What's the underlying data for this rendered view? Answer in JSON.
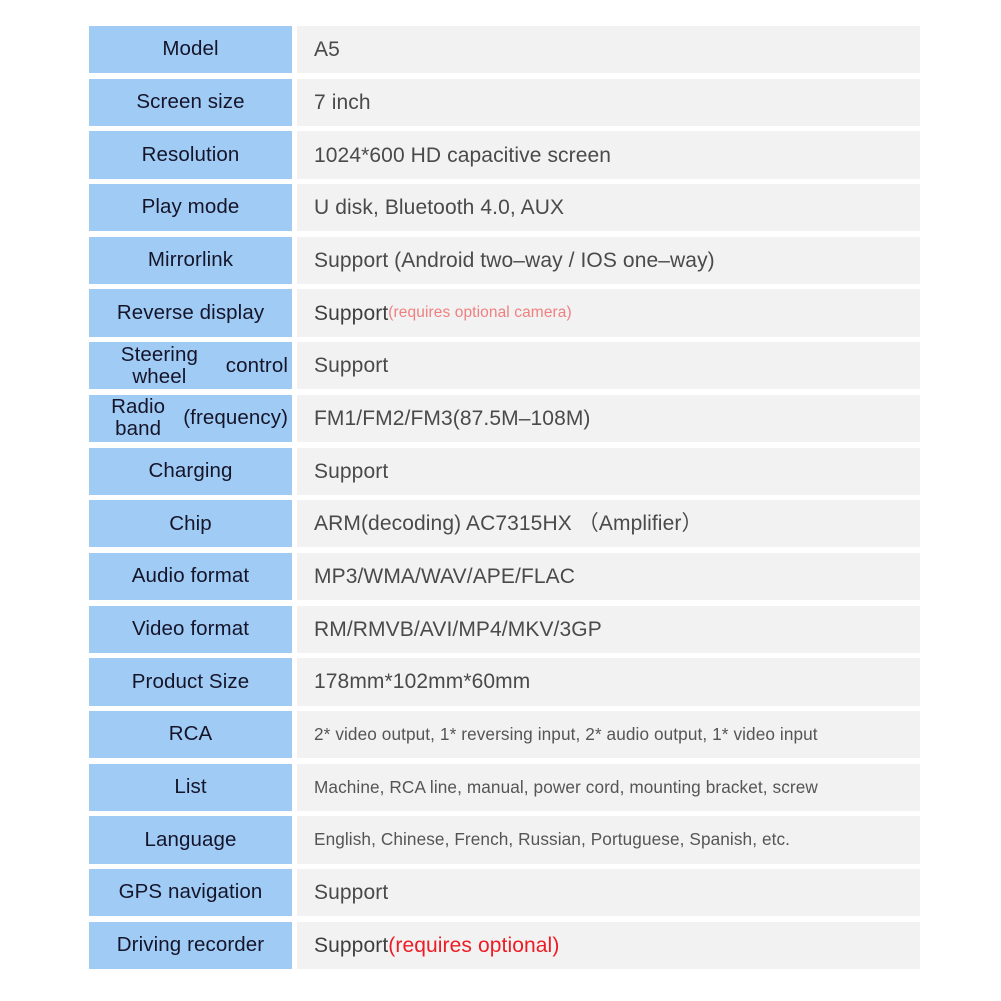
{
  "table": {
    "colors": {
      "label_background": "#a0cbf5",
      "value_background": "#f2f2f2",
      "label_text": "#15152a",
      "value_text": "#4a4a4a",
      "note_soft": "#f08080",
      "note_strong": "#ed1c24"
    },
    "rows": [
      {
        "label": "Model",
        "value": "A5"
      },
      {
        "label": "Screen size",
        "value": "7 inch"
      },
      {
        "label": "Resolution",
        "value": "1024*600 HD capacitive screen"
      },
      {
        "label": "Play mode",
        "value": "U disk, Bluetooth 4.0, AUX"
      },
      {
        "label": "Mirrorlink",
        "value": "Support (Android two–way / IOS one–way)"
      },
      {
        "label": "Reverse display",
        "value": "Support",
        "note": "(requires optional camera)",
        "note_style": "soft"
      },
      {
        "label": "Steering wheel control",
        "label_line1": "Steering wheel",
        "label_line2": "control",
        "value": "Support"
      },
      {
        "label": "Radio band (frequency)",
        "label_line1": "Radio band",
        "label_line2": "(frequency)",
        "value": "FM1/FM2/FM3(87.5M–108M)"
      },
      {
        "label": "Charging",
        "value": "Support"
      },
      {
        "label": "Chip",
        "value": "ARM(decoding)   AC7315HX （Amplifier）"
      },
      {
        "label": "Audio format",
        "value": "MP3/WMA/WAV/APE/FLAC"
      },
      {
        "label": "Video format",
        "value": "RM/RMVB/AVI/MP4/MKV/3GP"
      },
      {
        "label": "Product Size",
        "value": "178mm*102mm*60mm"
      },
      {
        "label": "RCA",
        "value": "2* video output, 1* reversing input, 2* audio output, 1* video input",
        "size": "small"
      },
      {
        "label": "List",
        "value": "Machine, RCA line, manual, power cord, mounting bracket, screw",
        "size": "small"
      },
      {
        "label": "Language",
        "value": "English, Chinese, French, Russian, Portuguese, Spanish, etc.",
        "size": "small"
      },
      {
        "label": "GPS navigation",
        "value": "Support"
      },
      {
        "label": "Driving recorder",
        "value": "Support",
        "note": "(requires optional)",
        "note_style": "strong"
      }
    ]
  }
}
